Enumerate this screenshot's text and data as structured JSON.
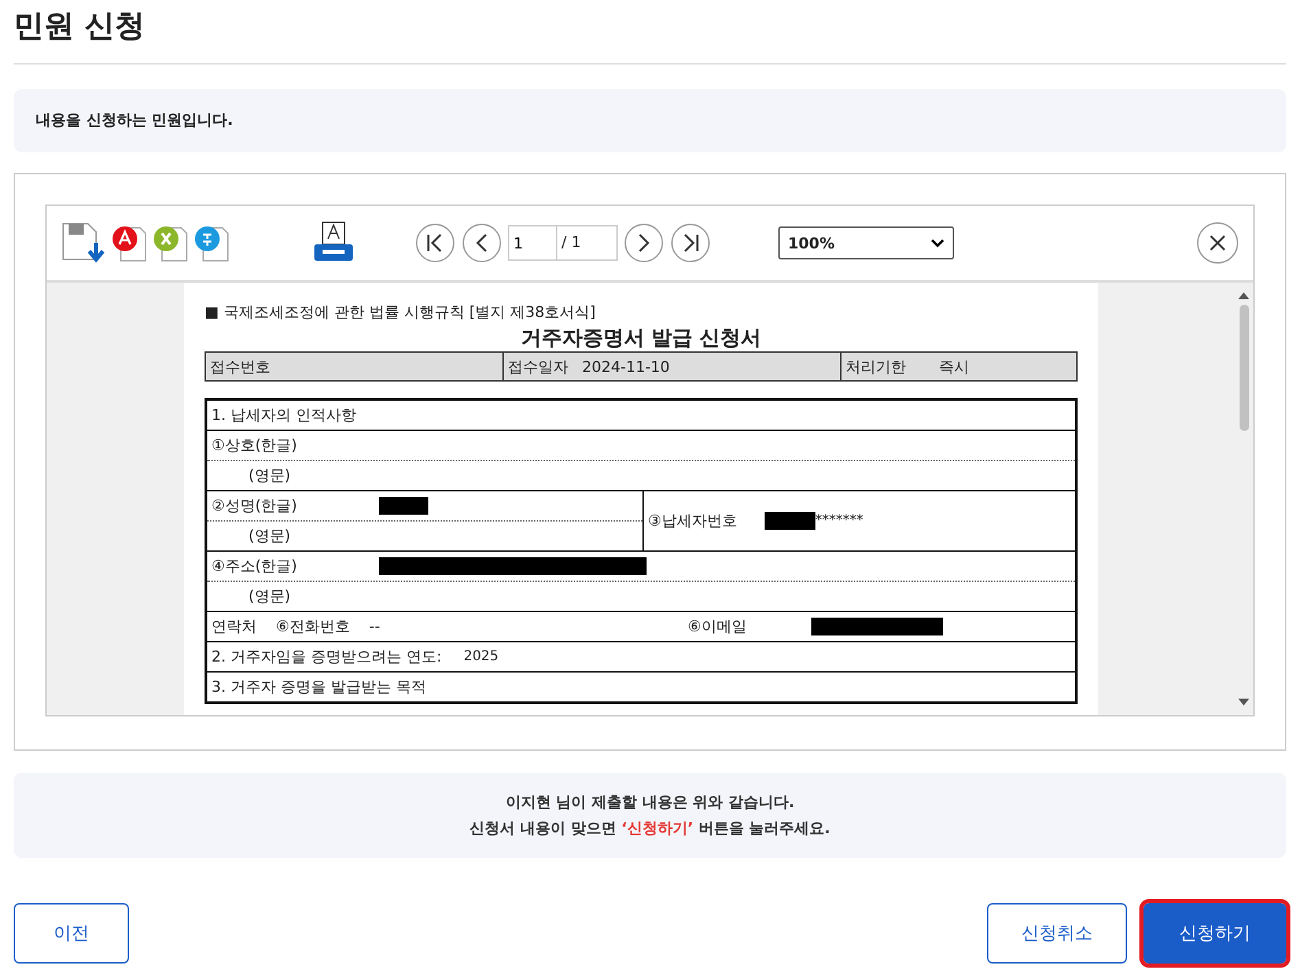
{
  "page_title": "민원 신청",
  "info_text": "내용을 신청하는 민원입니다.",
  "viewer": {
    "page_input": "1",
    "page_total": "/ 1",
    "zoom": "100%",
    "document": {
      "header_note": "■ 국제조세조정에 관한 법률 시행규칙 [별지 제38호서식]",
      "title": "거주자증명서 발급 신청서",
      "receipt": [
        {
          "label": "접수번호"
        },
        {
          "label": "접수일자",
          "value": "2024-11-10"
        },
        {
          "label": "처리기한",
          "value": "즉시"
        }
      ],
      "section1": "1. 납세자의 인적사항",
      "trade_name_kr": "①상호(한글)",
      "trade_name_en": "(영문)",
      "name_kr": "②성명(한글)",
      "name_en": "(영문)",
      "taxpayer_no_label": "③납세자번호",
      "taxpayer_no_suffix": "*******",
      "address_kr": "④주소(한글)",
      "address_en": "(영문)",
      "contact": "연락처",
      "phone_label": "⑥전화번호",
      "phone_value": "--",
      "email_label": "⑥이메일",
      "section2": "2. 거주자임을 증명받으려는 연도:",
      "year": "2025",
      "section3": "3. 거주자 증명을 발급받는 목적"
    }
  },
  "message": {
    "line1": "이지현 님이 제출할 내용은 위와 같습니다.",
    "line2_before": "신청서 내용이 맞으면 ",
    "line2_highlight": "‘신청하기’",
    "line2_after": " 버튼을 눌러주세요."
  },
  "buttons": [
    {
      "kind": "prev",
      "label": "이전",
      "highlighted": false
    },
    {
      "kind": "cancel",
      "label": "신청취소",
      "highlighted": false
    },
    {
      "kind": "submit",
      "label": "신청하기",
      "highlighted": true
    }
  ]
}
